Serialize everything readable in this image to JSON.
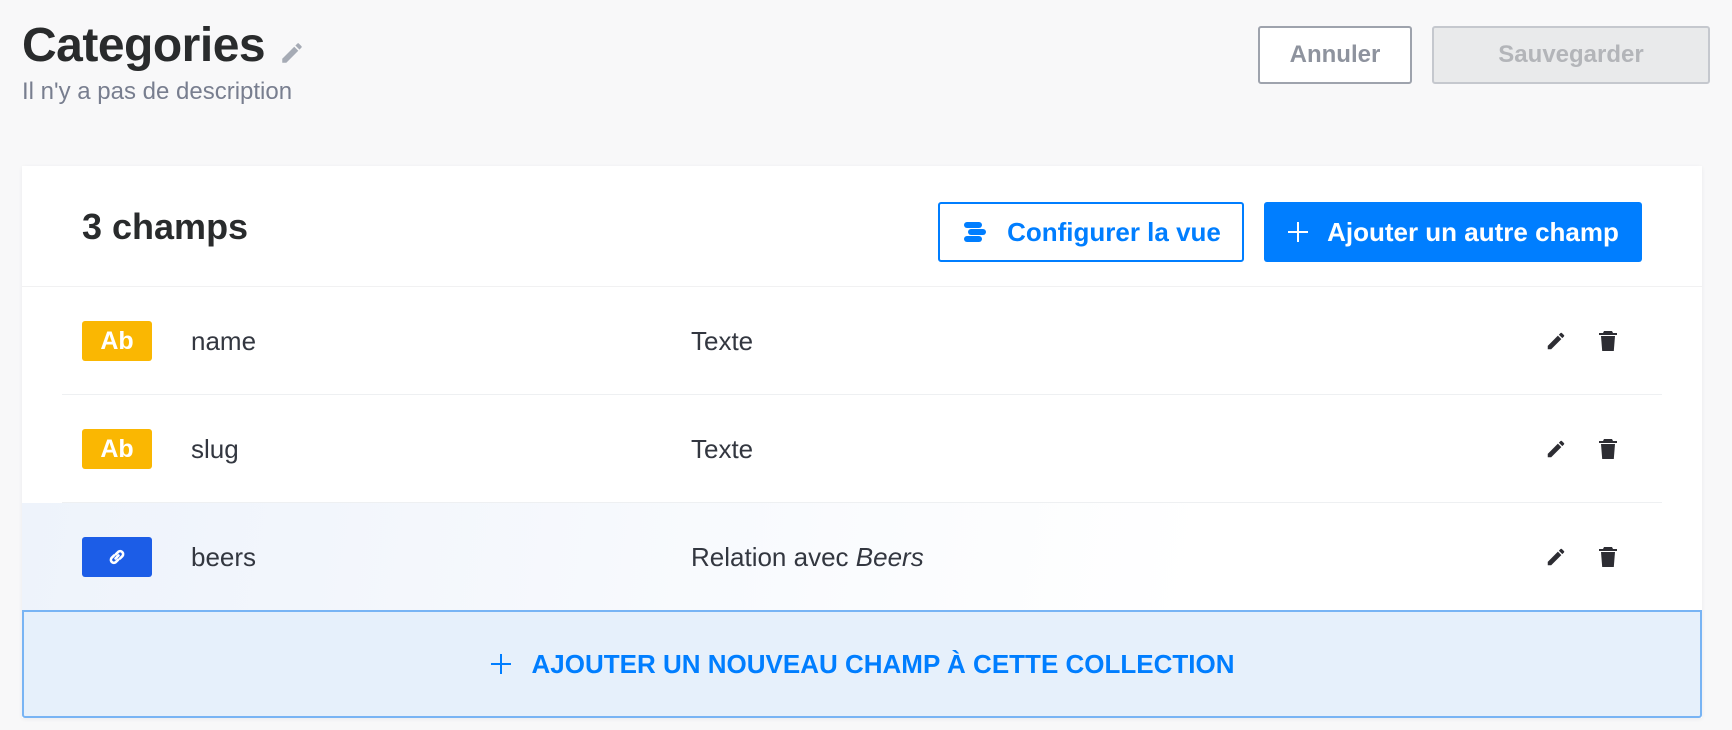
{
  "header": {
    "title": "Categories",
    "subtitle": "Il n'y a pas de description",
    "cancel_label": "Annuler",
    "save_label": "Sauvegarder"
  },
  "card": {
    "field_count": "3 champs",
    "configure_label": "Configurer la vue",
    "add_field_label": "Ajouter un autre champ",
    "add_new_label": "AJOUTER UN NOUVEAU CHAMP À CETTE COLLECTION"
  },
  "fields": [
    {
      "badge": "Ab",
      "badge_icon": "text-type-icon",
      "badge_color": "#fab702",
      "name": "name",
      "type": "Texte"
    },
    {
      "badge": "Ab",
      "badge_icon": "text-type-icon",
      "badge_color": "#fab702",
      "name": "slug",
      "type": "Texte"
    },
    {
      "badge_icon": "link-icon",
      "badge_color": "#1c5de7",
      "name": "beers",
      "type_prefix": "Relation avec",
      "type_target": "Beers"
    }
  ],
  "colors": {
    "accent": "#007eff",
    "text_badge": "#fab702",
    "relation_badge": "#1c5de7"
  }
}
